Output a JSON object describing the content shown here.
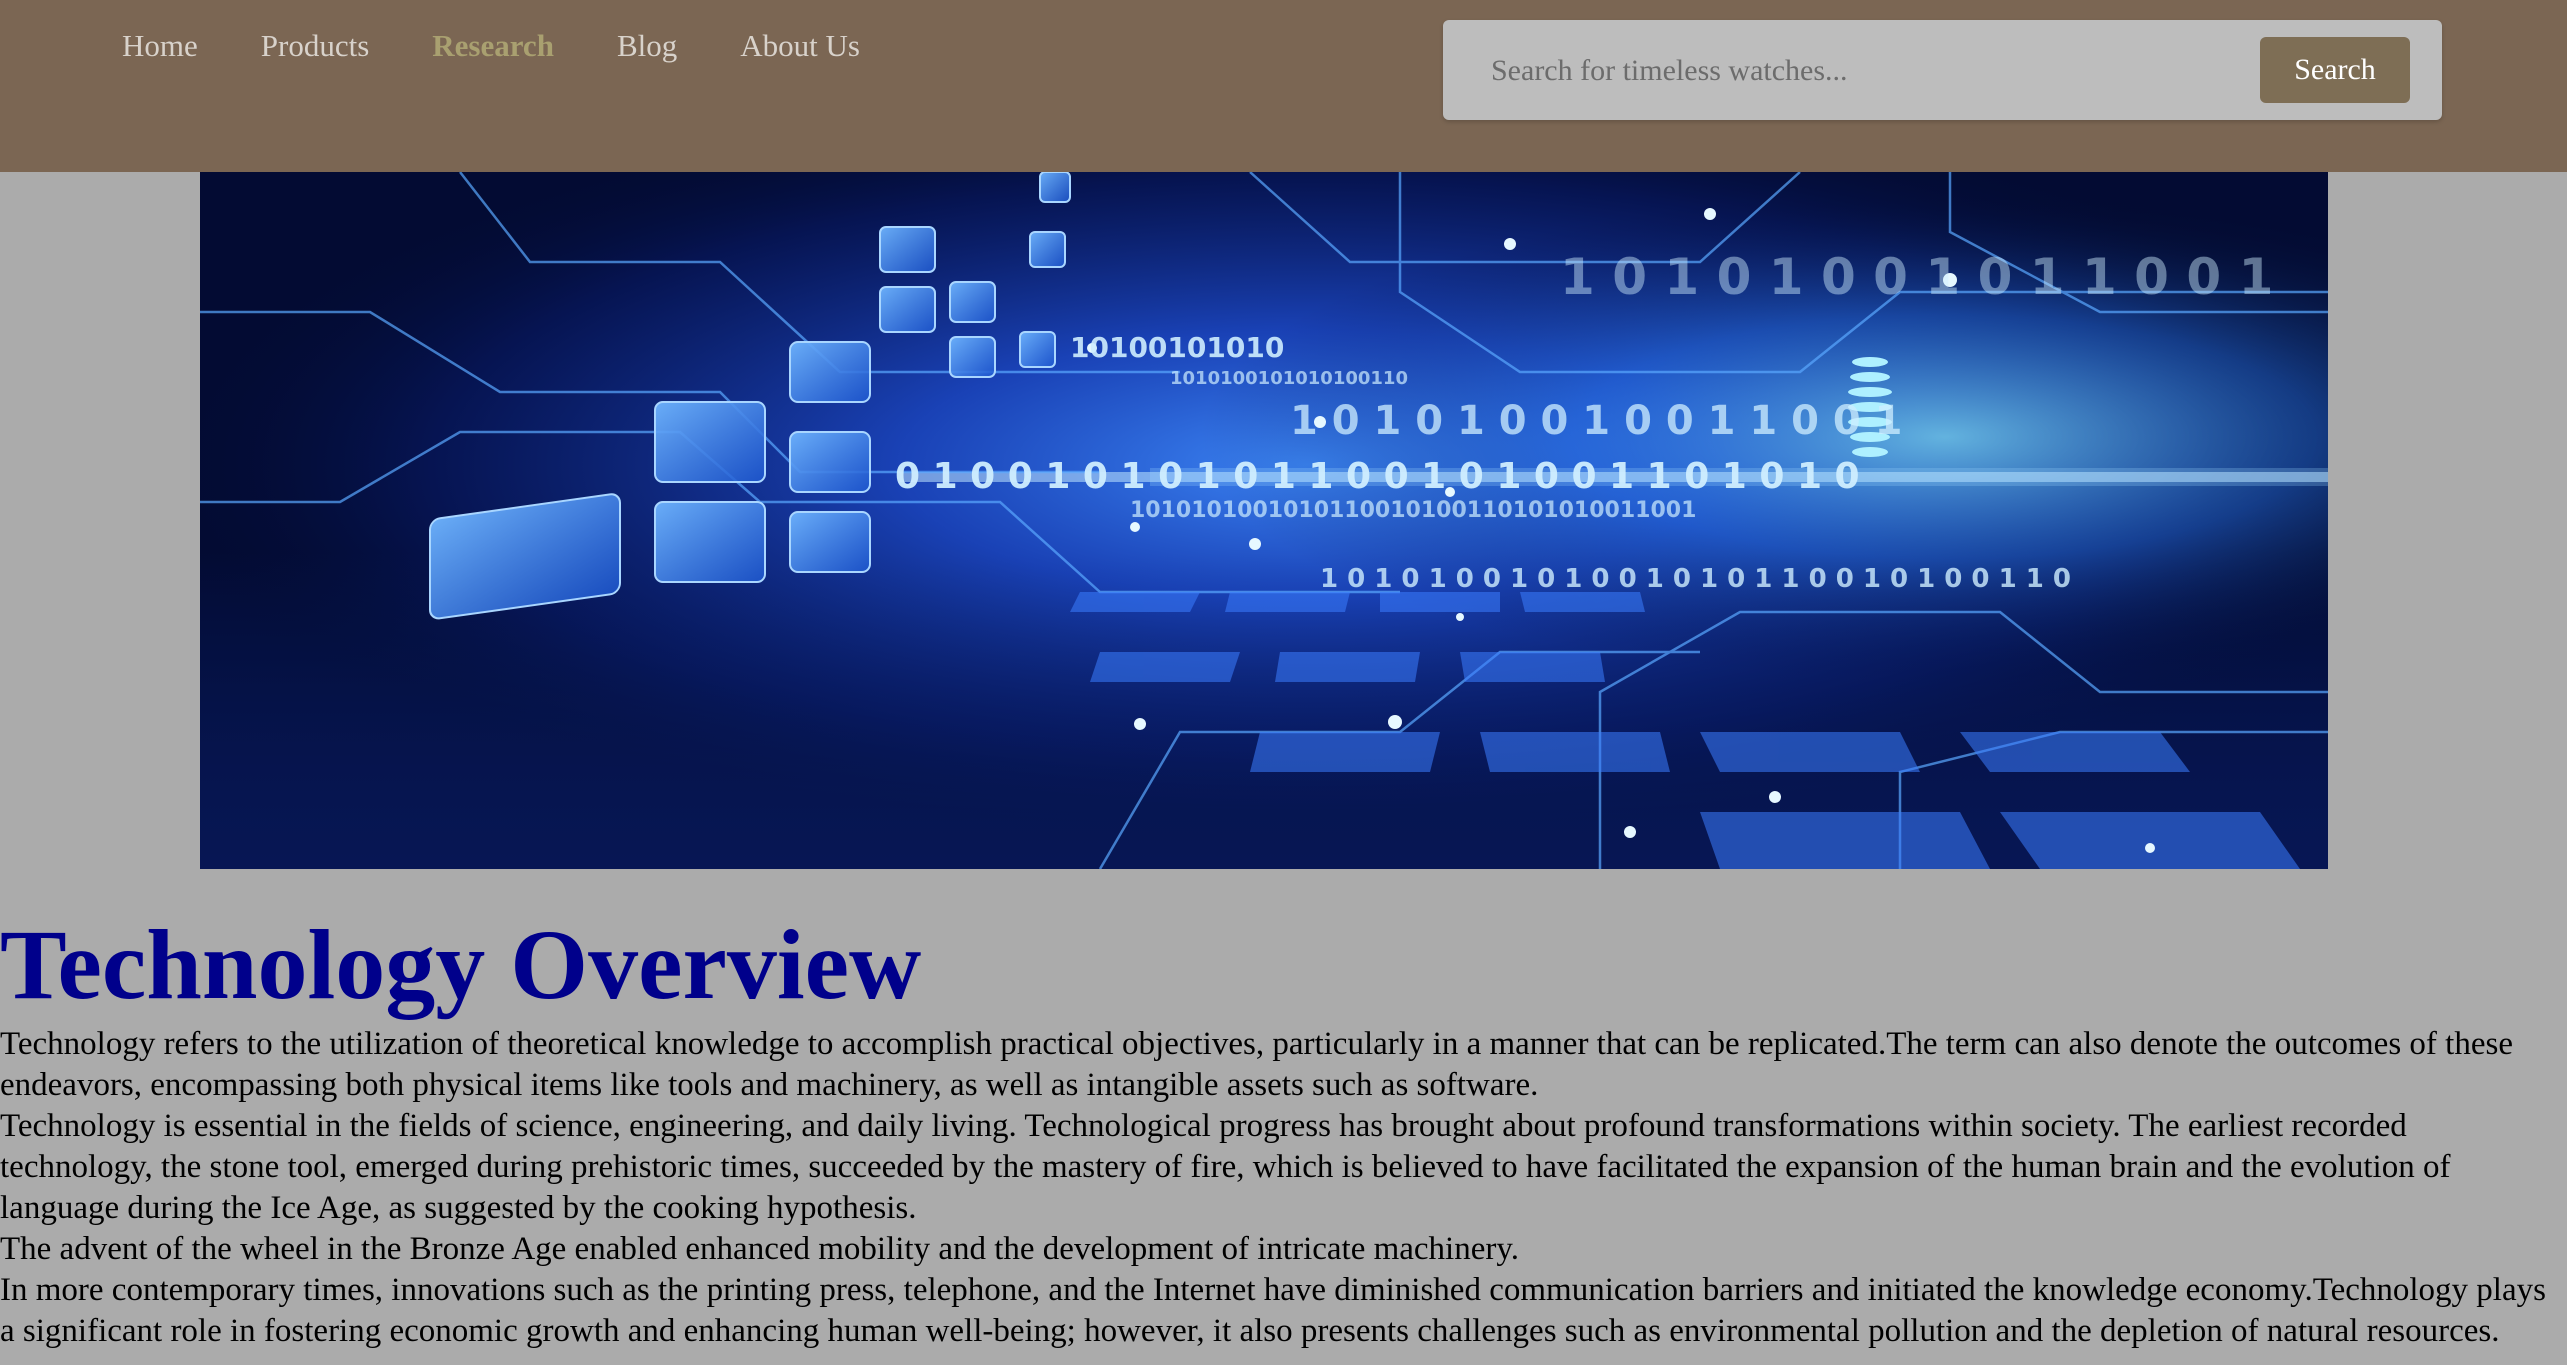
{
  "nav": {
    "items": [
      {
        "label": "Home",
        "active": false
      },
      {
        "label": "Products",
        "active": false
      },
      {
        "label": "Research",
        "active": true
      },
      {
        "label": "Blog",
        "active": false
      },
      {
        "label": "About Us",
        "active": false
      }
    ]
  },
  "search": {
    "placeholder": "Search for timeless watches...",
    "value": "",
    "button_label": "Search"
  },
  "hero": {
    "image": "technology-circuit-banner",
    "binary_rows": [
      "10100101010",
      "1010100101010100110",
      "1 0 1 0 1 0 0 1 0 0 1 1 0 0 1",
      "0 1 0 0 1 0 1 0 1 0 1 1 0 0 1 0 1 0 0 1 1 0 1 0 1 0",
      "1010101001010110010100110101010011001",
      "1 0 1 0 1 0 0 1 0 1 0 0 1 0 1 0 1 1 0 0 1 0 1 0 0 1 1 0",
      "1 0 1 0 1 0 0 1 0 1 1 0 0 1"
    ]
  },
  "article": {
    "title": "Technology Overview",
    "paragraphs": [
      "Technology refers to the utilization of theoretical knowledge to accomplish practical objectives, particularly in a manner that can be replicated.The term can also denote the outcomes of these endeavors, encompassing both physical items like tools and machinery, as well as intangible assets such as software.",
      "Technology is essential in the fields of science, engineering, and daily living. Technological progress has brought about profound transformations within society. The earliest recorded technology, the stone tool, emerged during prehistoric times, succeeded by the mastery of fire, which is believed to have facilitated the expansion of the human brain and the evolution of language during the Ice Age, as suggested by the cooking hypothesis.",
      "The advent of the wheel in the Bronze Age enabled enhanced mobility and the development of intricate machinery.",
      "In more contemporary times, innovations such as the printing press, telephone, and the Internet have diminished communication barriers and initiated the knowledge economy.Technology plays a significant role in fostering economic growth and enhancing human well-being; however, it also presents challenges such as environmental pollution and the depletion of natural resources."
    ]
  },
  "colors": {
    "header_bg": "#7b6653",
    "page_bg": "#ababab",
    "title": "#00008b",
    "active_nav": "#a9a070",
    "search_button": "#7e6e55"
  }
}
